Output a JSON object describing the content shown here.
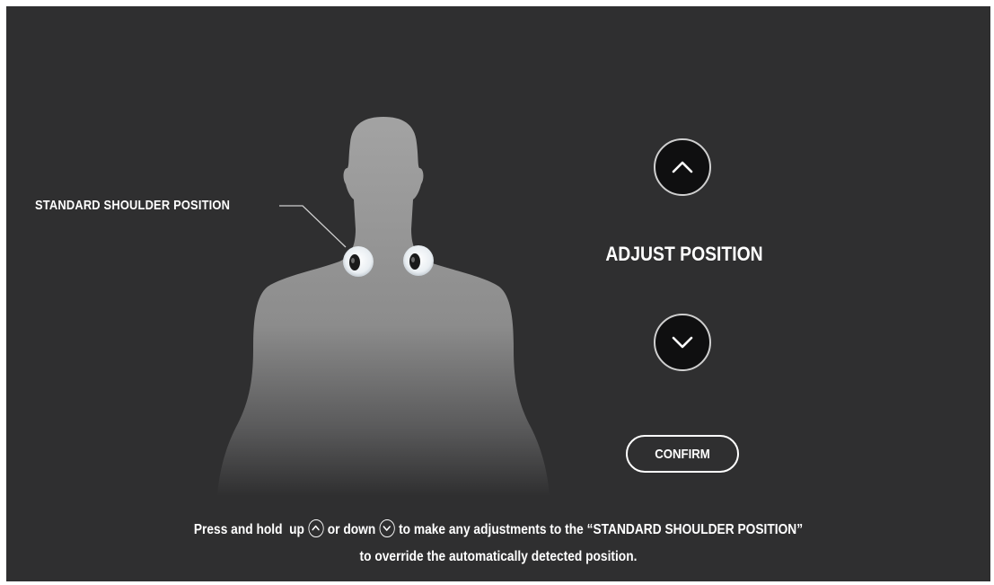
{
  "figure": {
    "shoulder_label": "STANDARD SHOULDER POSITION"
  },
  "controls": {
    "up_icon": "chevron-up-icon",
    "down_icon": "chevron-down-icon",
    "adjust_title": "ADJUST POSITION",
    "confirm_label": "CONFIRM"
  },
  "instructions": {
    "part1": "Press and hold  up",
    "part2": "or down",
    "part3": "to make any adjustments to the “STANDARD SHOULDER POSITION”",
    "line2": "to override the automatically detected position."
  },
  "colors": {
    "background": "#2f2f30",
    "button_fill": "#0f0f10",
    "text": "#ffffff"
  }
}
